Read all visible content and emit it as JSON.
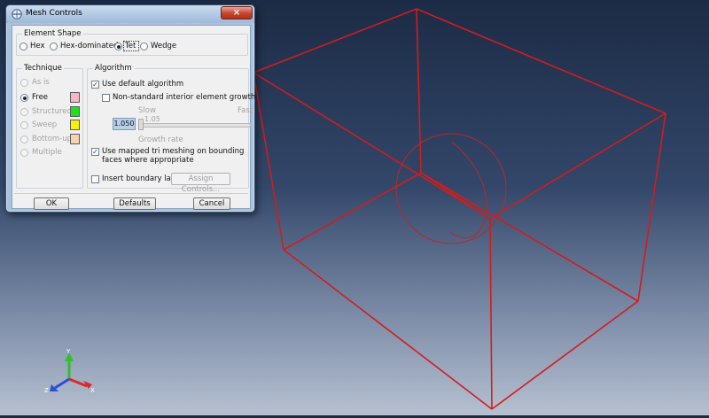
{
  "dialog": {
    "title": "Mesh Controls",
    "close_label": "×",
    "element_shape": {
      "label": "Element Shape",
      "options": [
        {
          "label": "Hex",
          "selected": false
        },
        {
          "label": "Hex-dominated",
          "selected": false
        },
        {
          "label": "Tet",
          "selected": true
        },
        {
          "label": "Wedge",
          "selected": false
        }
      ]
    },
    "technique": {
      "label": "Technique",
      "options": [
        {
          "label": "As is",
          "enabled": false,
          "selected": false,
          "color": null
        },
        {
          "label": "Free",
          "enabled": true,
          "selected": true,
          "color": "#f4b7c4"
        },
        {
          "label": "Structured",
          "enabled": false,
          "selected": false,
          "color": "#1fe01f"
        },
        {
          "label": "Sweep",
          "enabled": false,
          "selected": false,
          "color": "#f7f20a"
        },
        {
          "label": "Bottom-up",
          "enabled": false,
          "selected": false,
          "color": "#f6d3af"
        },
        {
          "label": "Multiple",
          "enabled": false,
          "selected": false,
          "color": null
        }
      ]
    },
    "algorithm": {
      "label": "Algorithm",
      "use_default": {
        "label": "Use default algorithm",
        "checked": true
      },
      "non_standard": {
        "label": "Non-standard interior element growth",
        "checked": false
      },
      "slider": {
        "slow_label": "Slow",
        "fast_label": "Fast",
        "value_label": "1.05",
        "field_value": "1.050",
        "caption": "Growth rate",
        "position": 0.0
      },
      "mapped_tri": {
        "label_line1": "Use mapped tri meshing on bounding",
        "label_line2": "faces where appropriate",
        "checked": true
      },
      "boundary_layer": {
        "label": "Insert boundary layer",
        "checked": false
      },
      "assign_controls_label": "Assign Controls..."
    },
    "buttons": {
      "ok": "OK",
      "defaults": "Defaults",
      "cancel": "Cancel"
    }
  },
  "triad": {
    "y": "Y",
    "z": "Z",
    "x": "X"
  },
  "colors": {
    "wireframe": "#d21c1c",
    "triad_y": "#2fbf2f",
    "triad_z": "#2a4fd8",
    "triad_x": "#d82a2a"
  }
}
